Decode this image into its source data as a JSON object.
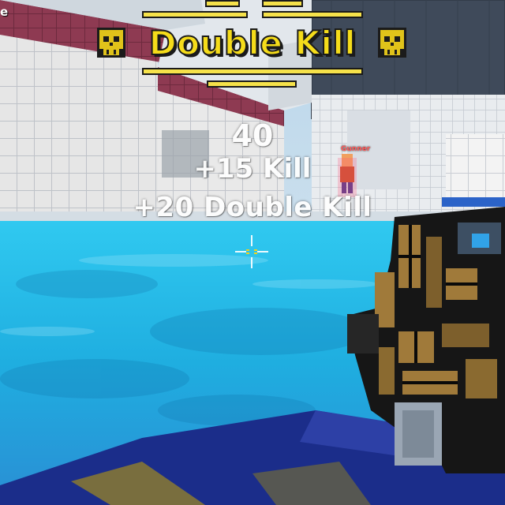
{
  "hud": {
    "corner_text": "e",
    "banner": {
      "title": "Double Kill",
      "icon_left": "skull-icon",
      "icon_right": "skull-icon",
      "color": "#f5dc1a"
    },
    "score_total": "40",
    "score_kill": "+15 Kill",
    "score_double_kill": "+20 Double Kill",
    "enemy_name": "Gunner",
    "crosshair_icon": "crosshair-icon"
  },
  "colors": {
    "water": "#1fb8e6",
    "wall": "#f2f2f2",
    "wall_stripe": "#8e3a52",
    "platform": "#f2d21a",
    "weapon_dark": "#161616",
    "weapon_gold": "#a07a3a",
    "floor_blue": "#1b2d8a"
  }
}
